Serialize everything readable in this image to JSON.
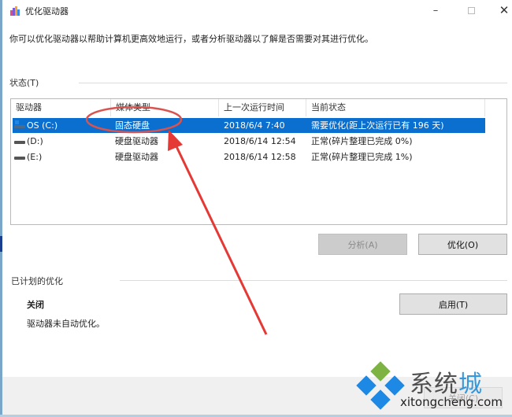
{
  "window": {
    "title": "优化驱动器",
    "controls": {
      "minimize": "–",
      "close": "✕"
    }
  },
  "intro_text": "你可以优化驱动器以帮助计算机更高效地运行，或者分析驱动器以了解是否需要对其进行优化。",
  "status_section": {
    "label": "状态(T)",
    "columns": [
      "驱动器",
      "媒体类型",
      "上一次运行时间",
      "当前状态"
    ],
    "rows": [
      {
        "drive": "OS (C:)",
        "media_type": "固态硬盘",
        "last_run": "2018/6/4 7:40",
        "status": "需要优化(距上次运行已有 196 天)",
        "selected": true,
        "icon": "system-drive-icon"
      },
      {
        "drive": "(D:)",
        "media_type": "硬盘驱动器",
        "last_run": "2018/6/14 12:54",
        "status": "正常(碎片整理已完成 0%)",
        "selected": false,
        "icon": "hard-drive-icon"
      },
      {
        "drive": "(E:)",
        "media_type": "硬盘驱动器",
        "last_run": "2018/6/14 12:58",
        "status": "正常(碎片整理已完成 1%)",
        "selected": false,
        "icon": "hard-drive-icon"
      }
    ],
    "buttons": {
      "analyze": "分析(A)",
      "optimize": "优化(O)"
    }
  },
  "scheduled_section": {
    "label": "已计划的优化",
    "state": "关闭",
    "description": "驱动器未自动优化。",
    "enable_button": "启用(T)"
  },
  "footer": {
    "close_button": "关闭(C)"
  },
  "annotation": {
    "color": "#e53935"
  },
  "watermark": {
    "brand_main": "系统",
    "brand_accent": "城",
    "url": "xitongcheng.com",
    "colors": {
      "green": "#7cb342",
      "blue": "#1e88e5",
      "accent": "#1788d8"
    }
  }
}
